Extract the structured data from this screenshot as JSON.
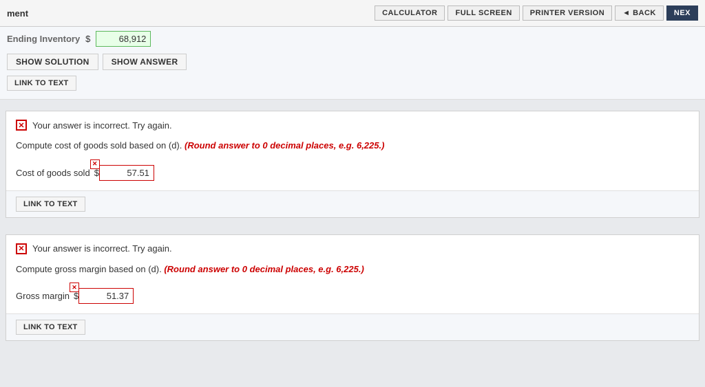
{
  "header": {
    "title": "ment",
    "buttons": {
      "calculator": "CALCULATOR",
      "fullscreen": "FULL SCREEN",
      "printer": "PRINTER VERSION",
      "back": "◄ BACK",
      "next": "NEX"
    }
  },
  "top_section": {
    "label": "Ending Inventory",
    "dollar": "$",
    "value": "68,912",
    "show_solution": "SHOW SOLUTION",
    "show_answer": "SHOW ANSWER",
    "link_to_text": "LINK TO TEXT"
  },
  "section1": {
    "error_msg": "Your answer is incorrect.  Try again.",
    "question": "Compute cost of goods sold based on (d).",
    "question_italic": "(Round answer to 0 decimal places, e.g. 6,225.)",
    "label": "Cost of goods sold",
    "dollar": "$",
    "value": "57.51",
    "link_to_text": "LINK TO TEXT"
  },
  "section2": {
    "error_msg": "Your answer is incorrect.  Try again.",
    "question": "Compute gross margin based on (d).",
    "question_italic": "(Round answer to 0 decimal places, e.g. 6,225.)",
    "label": "Gross margin",
    "dollar": "$",
    "value": "51.37",
    "link_to_text": "LINK TO TEXT"
  }
}
